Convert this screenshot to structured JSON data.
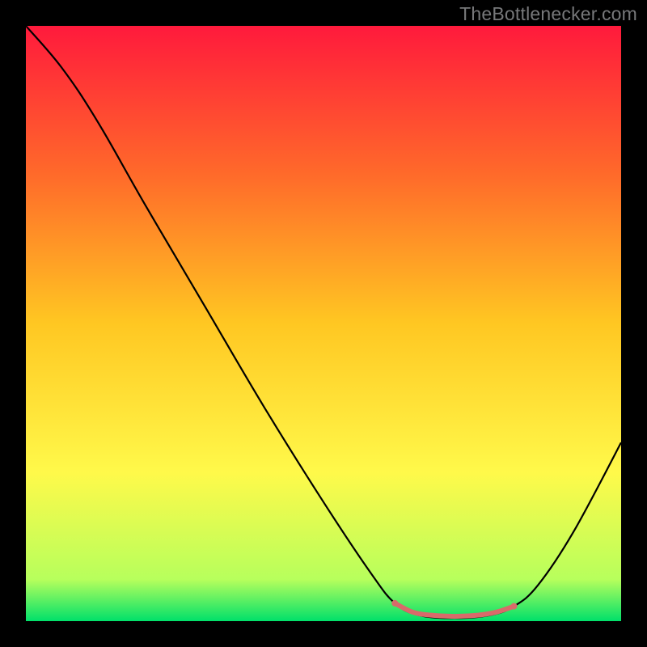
{
  "watermark": "TheBottlenecker.com",
  "chart_data": {
    "type": "line",
    "title": "",
    "xlabel": "",
    "ylabel": "",
    "xlim": [
      0,
      100
    ],
    "ylim": [
      0,
      100
    ],
    "background": {
      "type": "vertical-gradient",
      "stops": [
        {
          "offset": 0.0,
          "color": "#ff1a3c"
        },
        {
          "offset": 0.25,
          "color": "#ff6a2a"
        },
        {
          "offset": 0.5,
          "color": "#ffc722"
        },
        {
          "offset": 0.75,
          "color": "#fff94a"
        },
        {
          "offset": 0.93,
          "color": "#b7ff5c"
        },
        {
          "offset": 1.0,
          "color": "#00e06a"
        }
      ]
    },
    "series": [
      {
        "name": "bottleneck-curve",
        "color": "#000000",
        "stroke_width": 2.2,
        "points": [
          {
            "x": 0,
            "y": 100
          },
          {
            "x": 6,
            "y": 93
          },
          {
            "x": 12,
            "y": 84
          },
          {
            "x": 20,
            "y": 70
          },
          {
            "x": 30,
            "y": 53
          },
          {
            "x": 40,
            "y": 36
          },
          {
            "x": 50,
            "y": 20
          },
          {
            "x": 58,
            "y": 8
          },
          {
            "x": 62,
            "y": 3
          },
          {
            "x": 66,
            "y": 1
          },
          {
            "x": 72,
            "y": 0.5
          },
          {
            "x": 78,
            "y": 1
          },
          {
            "x": 82,
            "y": 2.5
          },
          {
            "x": 86,
            "y": 6
          },
          {
            "x": 92,
            "y": 15
          },
          {
            "x": 100,
            "y": 30
          }
        ]
      },
      {
        "name": "highlight-region",
        "color": "#d96a6a",
        "stroke_width": 6,
        "points": [
          {
            "x": 62,
            "y": 3
          },
          {
            "x": 65,
            "y": 1.5
          },
          {
            "x": 68,
            "y": 1
          },
          {
            "x": 72,
            "y": 0.8
          },
          {
            "x": 76,
            "y": 1
          },
          {
            "x": 79,
            "y": 1.5
          },
          {
            "x": 82,
            "y": 2.5
          }
        ],
        "endpoint_dots": true,
        "dot_radius": 4
      }
    ]
  }
}
